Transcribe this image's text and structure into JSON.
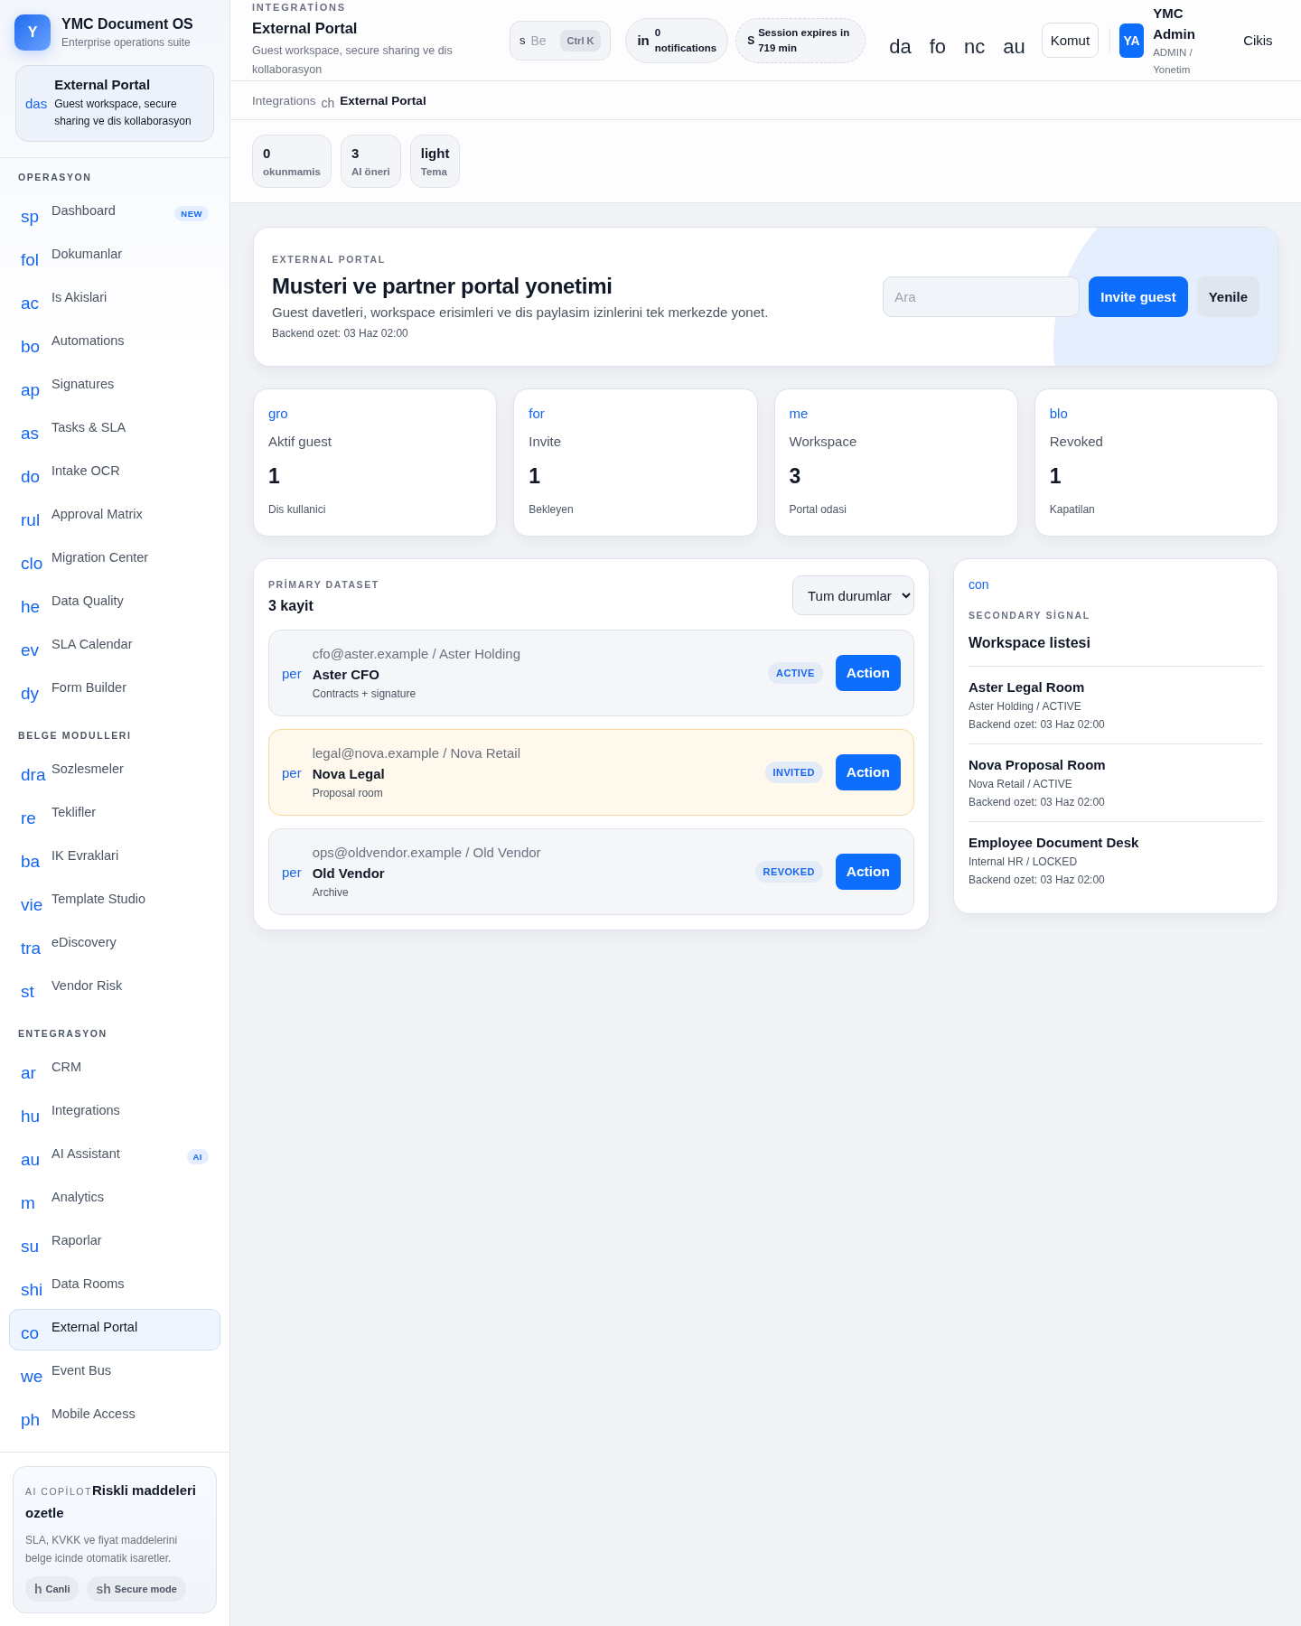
{
  "sidebar": {
    "brand": {
      "logo": "Y",
      "title": "YMC Document OS",
      "subtitle": "Enterprise operations suite"
    },
    "context": {
      "icon": "das",
      "title": "External Portal",
      "description": "Guest workspace, secure sharing ve dis kollaborasyon"
    },
    "sections": [
      {
        "title": "OPERASYON",
        "items": [
          {
            "icon": "sp",
            "label": "Dashboard",
            "badge": "NEW",
            "selected": false
          },
          {
            "icon": "fol",
            "label": "Dokumanlar",
            "selected": false
          },
          {
            "icon": "ac",
            "label": "Is Akislari",
            "selected": false
          },
          {
            "icon": "bo",
            "label": "Automations",
            "selected": false
          },
          {
            "icon": "ap",
            "label": "Signatures",
            "selected": false
          },
          {
            "icon": "as",
            "label": "Tasks & SLA",
            "selected": false
          },
          {
            "icon": "do",
            "label": "Intake OCR",
            "selected": false
          },
          {
            "icon": "rul",
            "label": "Approval Matrix",
            "selected": false
          },
          {
            "icon": "clo",
            "label": "Migration Center",
            "selected": false
          },
          {
            "icon": "he",
            "label": "Data Quality",
            "selected": false
          },
          {
            "icon": "ev",
            "label": "SLA Calendar",
            "selected": false
          },
          {
            "icon": "dy",
            "label": "Form Builder",
            "selected": false
          }
        ]
      },
      {
        "title": "BELGE MODULLERI",
        "items": [
          {
            "icon": "dra",
            "label": "Sozlesmeler",
            "selected": false
          },
          {
            "icon": "re",
            "label": "Teklifler",
            "selected": false
          },
          {
            "icon": "ba",
            "label": "IK Evraklari",
            "selected": false
          },
          {
            "icon": "vie",
            "label": "Template Studio",
            "selected": false
          },
          {
            "icon": "tra",
            "label": "eDiscovery",
            "selected": false
          },
          {
            "icon": "st",
            "label": "Vendor Risk",
            "selected": false
          }
        ]
      },
      {
        "title": "ENTEGRASYON",
        "items": [
          {
            "icon": "ar",
            "label": "CRM",
            "selected": false
          },
          {
            "icon": "hu",
            "label": "Integrations",
            "selected": false
          },
          {
            "icon": "au",
            "label": "AI Assistant",
            "badge": "AI",
            "selected": false
          },
          {
            "icon": "m",
            "label": "Analytics",
            "selected": false
          },
          {
            "icon": "su",
            "label": "Raporlar",
            "selected": false
          },
          {
            "icon": "shi",
            "label": "Data Rooms",
            "selected": false
          },
          {
            "icon": "co",
            "label": "External Portal",
            "selected": true
          },
          {
            "icon": "we",
            "label": "Event Bus",
            "selected": false
          },
          {
            "icon": "ph",
            "label": "Mobile Access",
            "selected": false
          }
        ]
      }
    ],
    "copilot": {
      "label": "AI COPİLOT",
      "title": "Riskli maddeleri ozetle",
      "text": "SLA, KVKK ve fiyat maddelerini belge icinde otomatik isaretler.",
      "chips": [
        {
          "icon": "h",
          "label": "Canli"
        },
        {
          "icon": "sh",
          "label": "Secure mode"
        }
      ]
    }
  },
  "topbar": {
    "eyebrow": "INTEGRATİONS",
    "title": "External Portal",
    "subtitle": "Guest workspace, secure sharing ve dis kollaborasyon",
    "search": {
      "icon": "s",
      "placeholder": "Be",
      "shortcut": "Ctrl K"
    },
    "notifications": {
      "icon": "in",
      "count": "0",
      "label": "notifications"
    },
    "session": {
      "icon": "S",
      "text": "Session expires in 719 min"
    },
    "tools": [
      "da",
      "fo",
      "nc",
      "au"
    ],
    "command": "Komut",
    "user": {
      "initials": "YA",
      "name": "YMC Admin",
      "role": "ADMIN / Yonetim"
    },
    "logout": "Cikis"
  },
  "breadcrumb": {
    "parent": "Integrations",
    "separator": "ch",
    "current": "External Portal"
  },
  "summary_pills": [
    {
      "value": "0",
      "label": "okunmamis"
    },
    {
      "value": "3",
      "label": "AI öneri"
    },
    {
      "value": "light",
      "label": "Tema"
    }
  ],
  "hero": {
    "eyebrow": "EXTERNAL PORTAL",
    "title": "Musteri ve partner portal yonetimi",
    "description": "Guest davetleri, workspace erisimleri ve dis paylasim izinlerini tek merkezde yonet.",
    "meta": "Backend ozet: 03 Haz 02:00",
    "search": {
      "placeholder": "Ara"
    },
    "primary_button": "Invite guest",
    "secondary_button": "Yenile"
  },
  "stats": [
    {
      "icon": "gro",
      "label": "Aktif guest",
      "value": "1",
      "note": "Dis kullanici"
    },
    {
      "icon": "for",
      "label": "Invite",
      "value": "1",
      "note": "Bekleyen"
    },
    {
      "icon": "me",
      "label": "Workspace",
      "value": "3",
      "note": "Portal odasi"
    },
    {
      "icon": "blo",
      "label": "Revoked",
      "value": "1",
      "note": "Kapatilan"
    }
  ],
  "primary": {
    "eyebrow": "PRİMARY DATASET",
    "count": "3 kayit",
    "filter": "Tum durumlar",
    "rows": [
      {
        "icon": "per",
        "contact": "cfo@aster.example / Aster Holding",
        "name": "Aster CFO",
        "detail": "Contracts + signature",
        "status": "ACTIVE",
        "highlighted": false,
        "action": "Action"
      },
      {
        "icon": "per",
        "contact": "legal@nova.example / Nova Retail",
        "name": "Nova Legal",
        "detail": "Proposal room",
        "status": "INVITED",
        "highlighted": true,
        "action": "Action"
      },
      {
        "icon": "per",
        "contact": "ops@oldvendor.example / Old Vendor",
        "name": "Old Vendor",
        "detail": "Archive",
        "status": "REVOKED",
        "highlighted": false,
        "action": "Action"
      }
    ]
  },
  "secondary": {
    "icon": "con",
    "eyebrow": "SECONDARY SİGNAL",
    "title": "Workspace listesi",
    "items": [
      {
        "name": "Aster Legal Room",
        "meta": "Aster Holding / ACTIVE",
        "updated": "Backend ozet: 03 Haz 02:00"
      },
      {
        "name": "Nova Proposal Room",
        "meta": "Nova Retail / ACTIVE",
        "updated": "Backend ozet: 03 Haz 02:00"
      },
      {
        "name": "Employee Document Desk",
        "meta": "Internal HR / LOCKED",
        "updated": "Backend ozet: 03 Haz 02:00"
      }
    ]
  }
}
